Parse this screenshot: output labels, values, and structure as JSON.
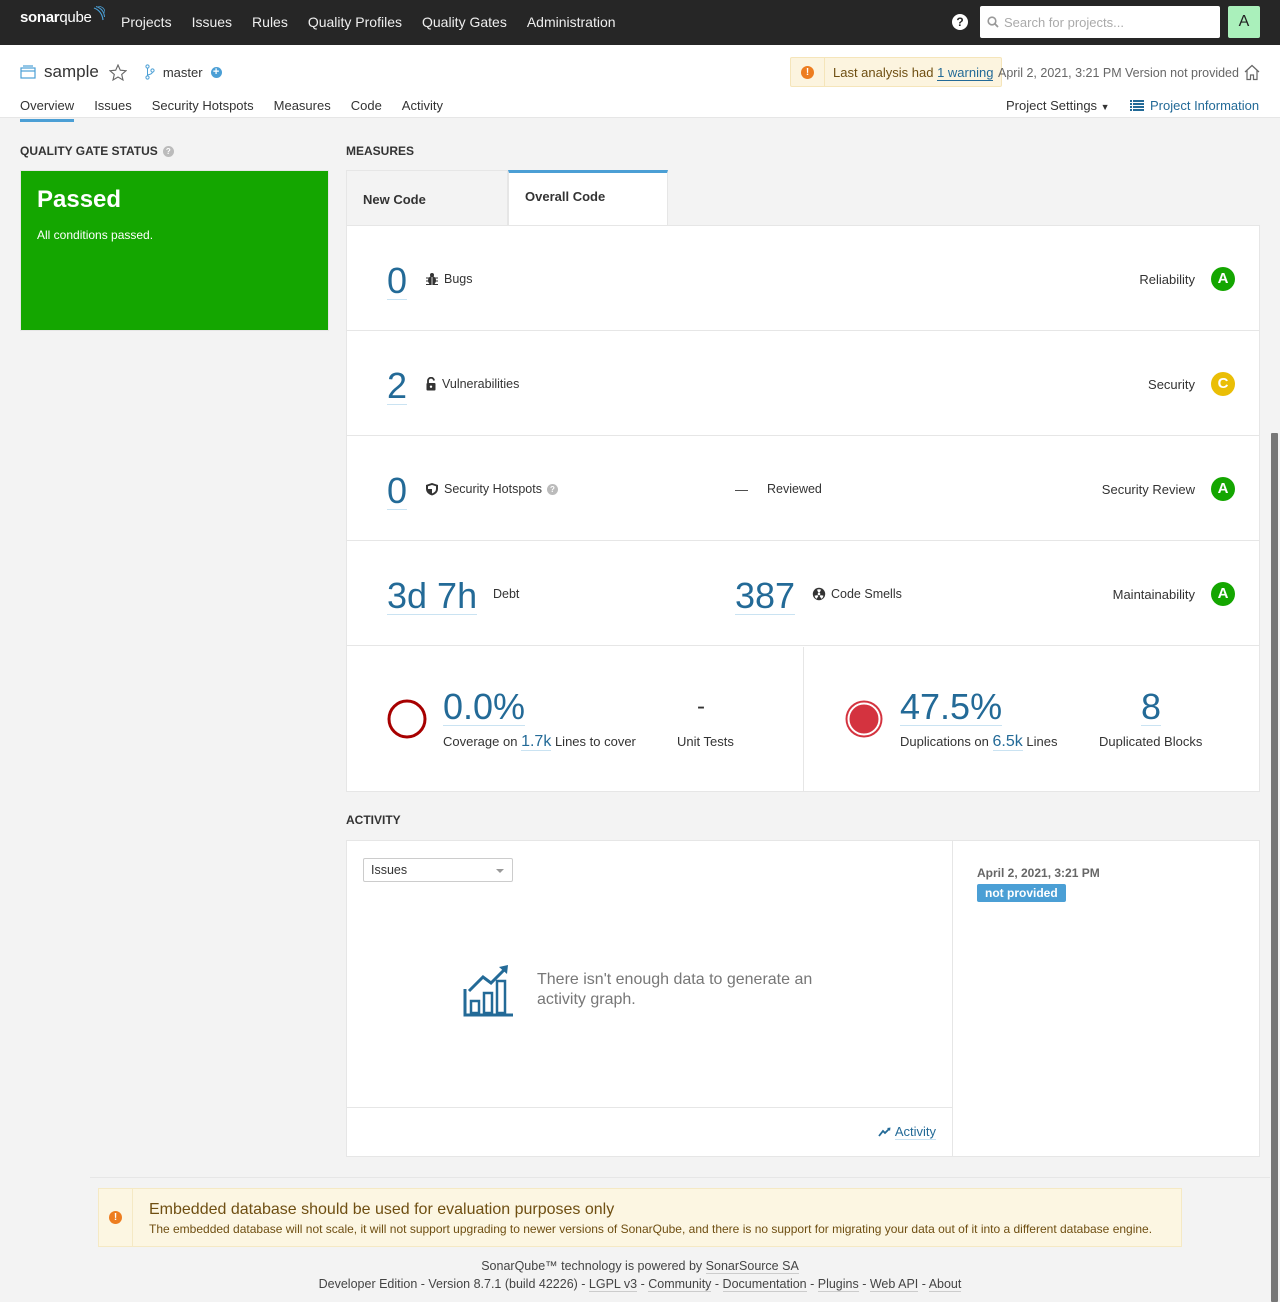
{
  "app": {
    "logo_bold": "sonar",
    "logo_light": "qube",
    "nav": [
      "Projects",
      "Issues",
      "Rules",
      "Quality Profiles",
      "Quality Gates",
      "Administration"
    ],
    "search_placeholder": "Search for projects...",
    "avatar_letter": "A",
    "help_glyph": "?"
  },
  "project": {
    "name": "sample",
    "branch": "master",
    "warning_prefix": "Last analysis had",
    "warning_link": "1 warning",
    "analysis_date": "April 2, 2021, 3:21 PM",
    "version": "Version not provided",
    "tabs": [
      "Overview",
      "Issues",
      "Security Hotspots",
      "Measures",
      "Code",
      "Activity"
    ],
    "active_tab": "Overview",
    "settings_label": "Project Settings",
    "info_label": "Project Information"
  },
  "quality_gate": {
    "title": "Quality Gate Status",
    "status": "Passed",
    "message": "All conditions passed.",
    "color": "#14a600"
  },
  "measures": {
    "title": "Measures",
    "tabs": [
      "New Code",
      "Overall Code"
    ],
    "active_tab": "Overall Code",
    "bugs": {
      "value": "0",
      "label": "Bugs",
      "rating_label": "Reliability",
      "rating": "A",
      "rating_color": "#14a600"
    },
    "vulnerabilities": {
      "value": "2",
      "label": "Vulnerabilities",
      "rating_label": "Security",
      "rating": "C",
      "rating_color": "#eabe06"
    },
    "hotspots": {
      "value": "0",
      "label": "Security Hotspots",
      "reviewed_value": "—",
      "reviewed_label": "Reviewed",
      "rating_label": "Security Review",
      "rating": "A",
      "rating_color": "#14a600"
    },
    "maintainability": {
      "debt_value": "3d 7h",
      "debt_label": "Debt",
      "smells_value": "387",
      "smells_label": "Code Smells",
      "rating_label": "Maintainability",
      "rating": "A",
      "rating_color": "#14a600"
    },
    "coverage": {
      "value": "0.0%",
      "label_prefix": "Coverage on",
      "lines": "1.7k",
      "label_suffix": "Lines to cover",
      "unit_tests_value": "-",
      "unit_tests_label": "Unit Tests"
    },
    "duplications": {
      "value": "47.5%",
      "label_prefix": "Duplications on",
      "lines": "6.5k",
      "label_suffix": "Lines",
      "blocks_value": "8",
      "blocks_label": "Duplicated Blocks"
    }
  },
  "activity": {
    "title": "Activity",
    "select_value": "Issues",
    "empty_message": "There isn't enough data to generate an activity graph.",
    "link_label": "Activity",
    "event_date": "April 2, 2021, 3:21 PM",
    "event_badge": "not provided"
  },
  "db_warning": {
    "title": "Embedded database should be used for evaluation purposes only",
    "text": "The embedded database will not scale, it will not support upgrading to newer versions of SonarQube, and there is no support for migrating your data out of it into a different database engine."
  },
  "footer": {
    "powered_prefix": "SonarQube™ technology is powered by",
    "powered_link": "SonarSource SA",
    "edition": "Developer Edition - Version 8.7.1 (build 42226)",
    "links": [
      "LGPL v3",
      "Community",
      "Documentation",
      "Plugins",
      "Web API",
      "About"
    ]
  }
}
